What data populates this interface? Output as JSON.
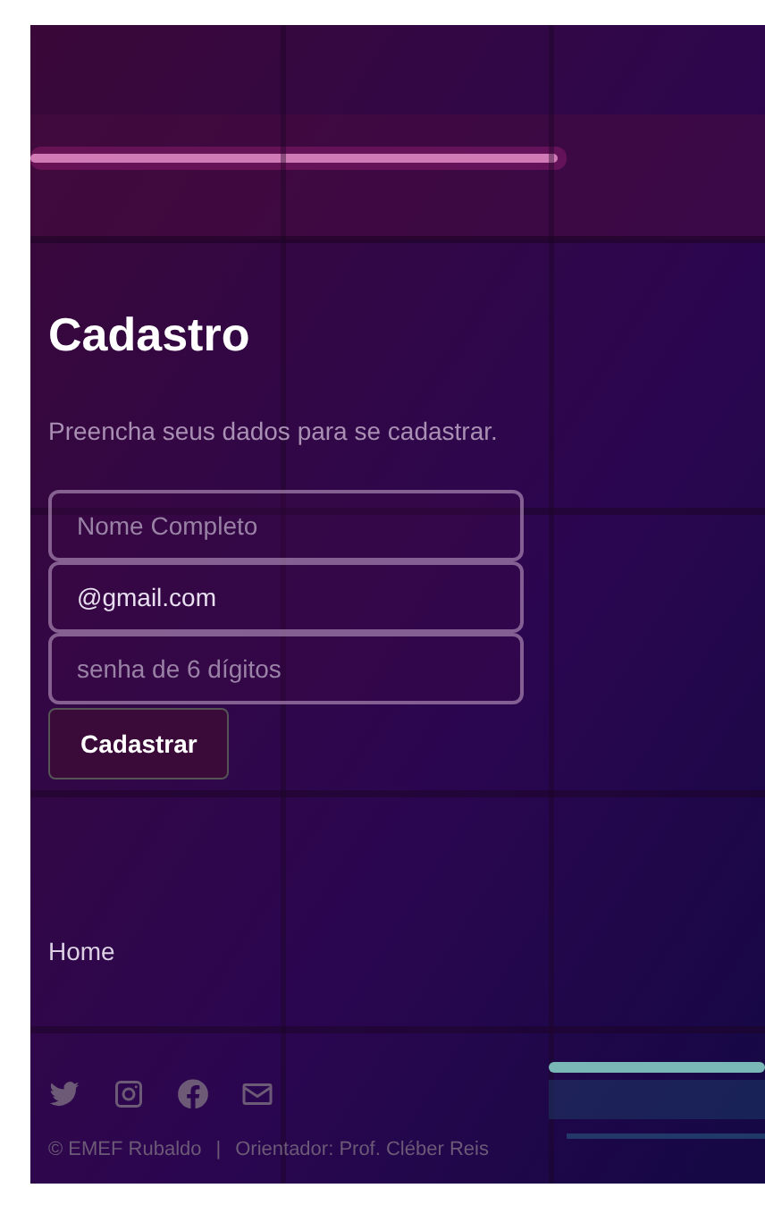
{
  "title": "Cadastro",
  "subtitle": "Preencha seus dados para se cadastrar.",
  "fields": [
    {
      "placeholder": "Nome Completo"
    },
    {
      "value": "@gmail.com"
    },
    {
      "placeholder": "senha de 6 dígitos"
    }
  ],
  "submit_button": "Cadastrar",
  "nav_links": [
    "Home"
  ],
  "footer": {
    "copyright": "© EMEF Rubaldo",
    "separator": "|",
    "credit": "Orientador: Prof. Cléber Reis"
  }
}
